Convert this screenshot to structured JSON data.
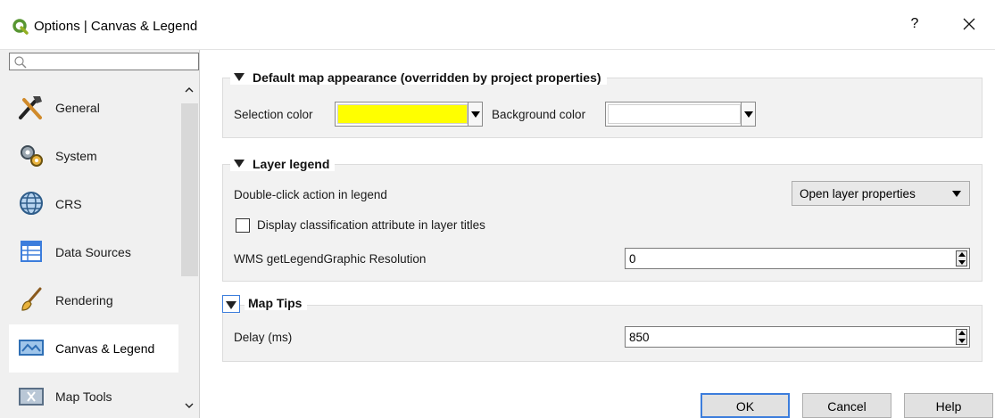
{
  "window": {
    "title": "Options | Canvas & Legend",
    "help": "?"
  },
  "sidebar": {
    "search_placeholder": "",
    "items": [
      {
        "label": "General",
        "icon": "tools-icon"
      },
      {
        "label": "System",
        "icon": "gears-icon"
      },
      {
        "label": "CRS",
        "icon": "globe-icon"
      },
      {
        "label": "Data Sources",
        "icon": "table-icon"
      },
      {
        "label": "Rendering",
        "icon": "paintbrush-icon"
      },
      {
        "label": "Canvas & Legend",
        "icon": "map-canvas-icon",
        "selected": true
      },
      {
        "label": "Map Tools",
        "icon": "map-tools-icon"
      }
    ]
  },
  "default_map": {
    "title": "Default map appearance (overridden by project properties)",
    "selection_label": "Selection color",
    "selection_color": "#ffff00",
    "background_label": "Background color",
    "background_color": "#ffffff"
  },
  "layer_legend": {
    "title": "Layer legend",
    "double_click_label": "Double-click action in legend",
    "double_click_value": "Open layer properties",
    "classification_label": "Display classification attribute in layer titles",
    "classification_checked": false,
    "wms_label": "WMS getLegendGraphic Resolution",
    "wms_value": "0"
  },
  "map_tips": {
    "title": "Map Tips",
    "delay_label": "Delay (ms)",
    "delay_value": "850"
  },
  "buttons": {
    "ok": "OK",
    "cancel": "Cancel",
    "help": "Help"
  },
  "colors": {
    "accent": "#3c7ddc",
    "sidebar_bg": "#f0f0f0",
    "group_bg": "#f2f2f2"
  }
}
